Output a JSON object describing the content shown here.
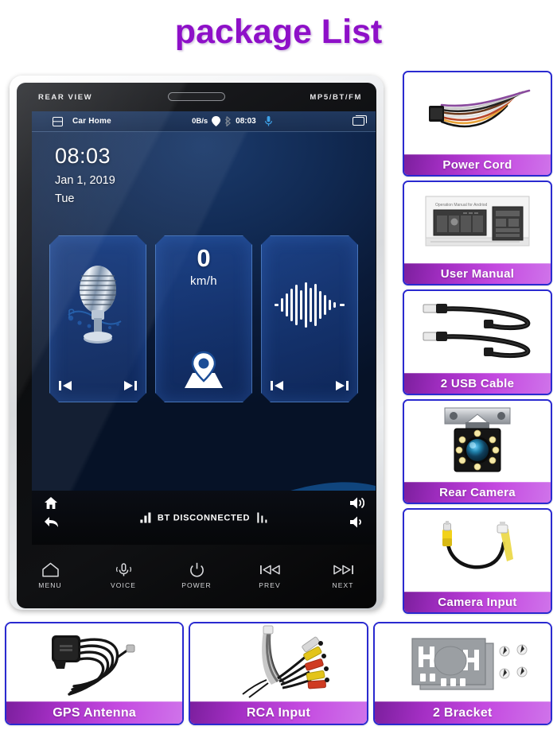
{
  "page": {
    "title": "package List",
    "title_color": "#8e10c8"
  },
  "head_unit": {
    "bezel": {
      "rear_view_label": "REAR  VIEW",
      "format_label": "MP5/BT/FM",
      "speaker_icon": "speaker-slot"
    },
    "status_bar": {
      "menu_icon": "menu-icon",
      "app_title": "Car Home",
      "data_rate": "0B/s",
      "location_icon": "location-pin-icon",
      "bluetooth_icon": "bluetooth-icon",
      "clock": "08:03",
      "mic_icon": "microphone-icon",
      "recents_icon": "recent-apps-icon"
    },
    "clock_widget": {
      "time": "08:03",
      "date": "Jan 1, 2019",
      "weekday": "Tue"
    },
    "widgets": [
      {
        "name": "radio-widget",
        "icon": "vintage-microphone-icon",
        "prev_icon": "previous-track-icon",
        "next_icon": "next-track-icon"
      },
      {
        "name": "speed-navigation-widget",
        "speed_value": "0",
        "speed_unit": "km/h",
        "icon": "map-pin-icon"
      },
      {
        "name": "music-widget",
        "icon": "audio-waveform-icon",
        "prev_icon": "previous-track-icon",
        "next_icon": "next-track-icon"
      }
    ],
    "screen_footer": {
      "home_icon": "home-icon",
      "back_icon": "back-arrow-icon",
      "bt_status": "BT DISCONNECTED",
      "volume_up_icon": "volume-up-icon",
      "volume_down_icon": "volume-down-icon"
    },
    "hardware_buttons": [
      {
        "label": "MENU",
        "icon": "home-outline-icon"
      },
      {
        "label": "VOICE",
        "icon": "microphone-icon"
      },
      {
        "label": "POWER",
        "icon": "power-icon"
      },
      {
        "label": "PREV",
        "icon": "previous-track-icon"
      },
      {
        "label": "NEXT",
        "icon": "next-track-icon"
      }
    ]
  },
  "accessories_right": [
    {
      "label": "Power  Cord",
      "art": "wire-harness"
    },
    {
      "label": "User Manual",
      "art": "manual-booklet"
    },
    {
      "label": "2 USB Cable",
      "art": "usb-cables"
    },
    {
      "label": "Rear Camera",
      "art": "rear-camera"
    },
    {
      "label": "Camera Input",
      "art": "rca-extension-cable"
    }
  ],
  "accessories_bottom": [
    {
      "label": "GPS  Antenna",
      "art": "gps-antenna"
    },
    {
      "label": "RCA Input",
      "art": "rca-fan-cable"
    },
    {
      "label": "2 Bracket",
      "art": "mounting-brackets"
    }
  ],
  "colors": {
    "title_purple": "#8e10c8",
    "card_border_blue": "#2a2ad0",
    "label_gradient_start": "#7c1f9e",
    "label_gradient_end": "#cf73ea",
    "screen_blue": "#112a53"
  }
}
